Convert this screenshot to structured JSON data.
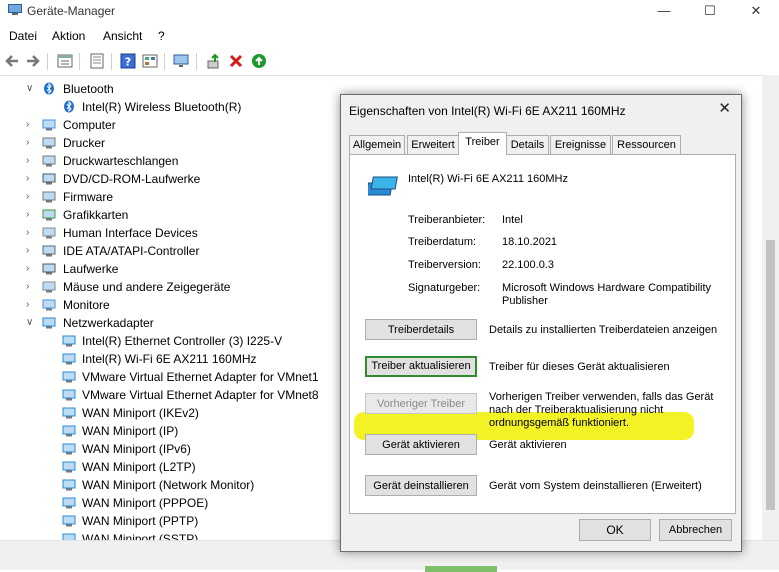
{
  "window": {
    "title": "Geräte-Manager",
    "minimize_icon": "minimize-icon",
    "maximize_icon": "maximize-icon",
    "close_icon": "close-icon"
  },
  "menu": [
    "Datei",
    "Aktion",
    "Ansicht",
    "?"
  ],
  "toolbar_icons": [
    "back-arrow-icon",
    "forward-arrow-icon",
    "properties-icon",
    "list-view-icon",
    "help-icon",
    "device-view-icon",
    "monitor-scan-icon",
    "update-driver-icon",
    "uninstall-x-icon",
    "enable-device-icon"
  ],
  "tree": [
    {
      "label": "Bluetooth",
      "expanded": true,
      "icon": "bluetooth-icon"
    },
    {
      "label": "Intel(R) Wireless Bluetooth(R)",
      "icon": "bluetooth-device-icon"
    },
    {
      "label": "Computer",
      "icon": "computer-icon"
    },
    {
      "label": "Drucker",
      "icon": "printer-icon"
    },
    {
      "label": "Druckwarteschlangen",
      "icon": "print-queue-icon"
    },
    {
      "label": "DVD/CD-ROM-Laufwerke",
      "icon": "dvd-icon"
    },
    {
      "label": "Firmware",
      "icon": "firmware-icon"
    },
    {
      "label": "Grafikkarten",
      "icon": "graphics-card-icon"
    },
    {
      "label": "Human Interface Devices",
      "icon": "hid-icon"
    },
    {
      "label": "IDE ATA/ATAPI-Controller",
      "icon": "ide-controller-icon"
    },
    {
      "label": "Laufwerke",
      "icon": "drive-icon"
    },
    {
      "label": "Mäuse und andere Zeigegeräte",
      "icon": "mouse-icon"
    },
    {
      "label": "Monitore",
      "icon": "monitor-icon"
    },
    {
      "label": "Netzwerkadapter",
      "expanded": true,
      "icon": "network-adapter-icon"
    },
    {
      "label": "Intel(R) Ethernet Controller (3) I225-V",
      "icon": "network-card-icon"
    },
    {
      "label": "Intel(R) Wi-Fi 6E AX211 160MHz",
      "icon": "network-card-icon"
    },
    {
      "label": "VMware Virtual Ethernet Adapter for VMnet1",
      "icon": "network-card-icon"
    },
    {
      "label": "VMware Virtual Ethernet Adapter for VMnet8",
      "icon": "network-card-icon"
    },
    {
      "label": "WAN Miniport (IKEv2)",
      "icon": "network-card-icon"
    },
    {
      "label": "WAN Miniport (IP)",
      "icon": "network-card-icon"
    },
    {
      "label": "WAN Miniport (IPv6)",
      "icon": "network-card-icon"
    },
    {
      "label": "WAN Miniport (L2TP)",
      "icon": "network-card-icon"
    },
    {
      "label": "WAN Miniport (Network Monitor)",
      "icon": "network-card-icon"
    },
    {
      "label": "WAN Miniport (PPPOE)",
      "icon": "network-card-icon"
    },
    {
      "label": "WAN Miniport (PPTP)",
      "icon": "network-card-icon"
    },
    {
      "label": "WAN Miniport (SSTP)",
      "icon": "network-card-icon"
    }
  ],
  "dialog": {
    "title": "Eigenschaften von Intel(R) Wi-Fi 6E AX211 160MHz",
    "tabs": [
      "Allgemein",
      "Erweitert",
      "Treiber",
      "Details",
      "Ereignisse",
      "Ressourcen"
    ],
    "active_tab": "Treiber",
    "device_name": "Intel(R) Wi-Fi 6E AX211 160MHz",
    "props": [
      {
        "label": "Treiberanbieter:",
        "value": "Intel"
      },
      {
        "label": "Treiberdatum:",
        "value": "18.10.2021"
      },
      {
        "label": "Treiberversion:",
        "value": "22.100.0.3"
      },
      {
        "label": "Signaturgeber:",
        "value": "Microsoft Windows Hardware Compatibility Publisher"
      }
    ],
    "buttons": [
      {
        "label": "Treiberdetails",
        "desc": "Details zu installierten Treiberdateien anzeigen"
      },
      {
        "label": "Treiber aktualisieren",
        "desc": "Treiber für dieses Gerät aktualisieren"
      },
      {
        "label": "Vorheriger Treiber",
        "desc": "Vorherigen Treiber verwenden, falls das Gerät nach der Treiberaktualisierung nicht ordnungsgemäß funktioniert."
      },
      {
        "label": "Gerät aktivieren",
        "desc": "Gerät aktivieren"
      },
      {
        "label": "Gerät deinstallieren",
        "desc": "Gerät vom System deinstallieren (Erweitert)"
      }
    ],
    "ok_label": "OK",
    "cancel_label": "Abbrechen",
    "highlight_color": "#f2f224"
  }
}
